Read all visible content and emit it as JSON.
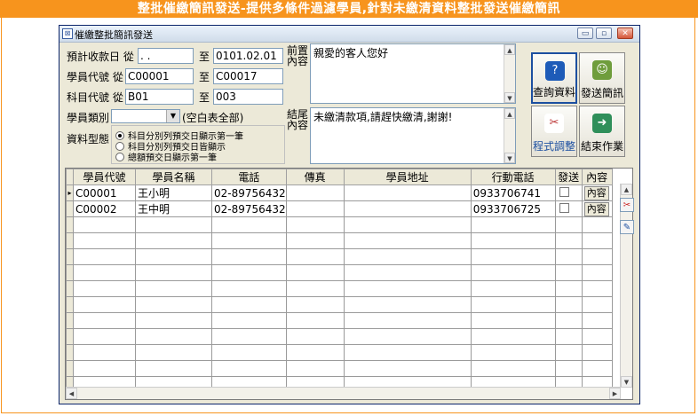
{
  "banner": {
    "title": "整批催繳簡訊發送-提供多條件過濾學員,針對未繳清資料整批發送催繳簡訊"
  },
  "window": {
    "title": "催繳整批簡訊發送",
    "controls": {
      "minimize": "▭",
      "restore": "▫",
      "close": "✕"
    }
  },
  "filters": {
    "date_label": "預計收款日 從",
    "date_from": "  .  .",
    "date_to_label": "至",
    "date_to": "0101.02.01",
    "student_label": "學員代號 從",
    "student_from": "C00001",
    "student_to_label": "至",
    "student_to": "C00017",
    "subject_label": "科目代號 從",
    "subject_from": "B01",
    "subject_to_label": "至",
    "subject_to": "003",
    "category_label": "學員類別",
    "category_value": "",
    "category_hint": "(空白表全部)",
    "data_type_label": "資料型態",
    "data_type_options": [
      {
        "label": "科目分別列預交日顯示第一筆",
        "selected": true
      },
      {
        "label": "科目分別列預交日皆顯示",
        "selected": false
      },
      {
        "label": "總額預交日顯示第一筆",
        "selected": false
      }
    ]
  },
  "message": {
    "prefix_label_1": "前置",
    "prefix_label_2": "內容",
    "prefix_text": "親愛的客人您好",
    "suffix_label_1": "結尾",
    "suffix_label_2": "內容",
    "suffix_text": "未繳清款項,請趕快繳清,謝謝!"
  },
  "actions": {
    "query": "查詢資料",
    "send": "發送簡訊",
    "config": "程式調整",
    "exit": "結束作業"
  },
  "table": {
    "columns": [
      "學員代號",
      "學員名稱",
      "電話",
      "傳真",
      "學員地址",
      "行動電話",
      "發送",
      "內容"
    ],
    "rows": [
      {
        "id": "C00001",
        "name": "王小明",
        "phone": "02-89756432",
        "fax": "",
        "address": "",
        "mobile": "0933706741",
        "send": false,
        "content": "內容"
      },
      {
        "id": "C00002",
        "name": "王中明",
        "phone": "02-89756432",
        "fax": "",
        "address": "",
        "mobile": "0933706725",
        "send": false,
        "content": "內容"
      }
    ]
  },
  "colors": {
    "banner": "#f7941d",
    "window_bg": "#ece9d8",
    "accent": "#1c4fa0"
  }
}
